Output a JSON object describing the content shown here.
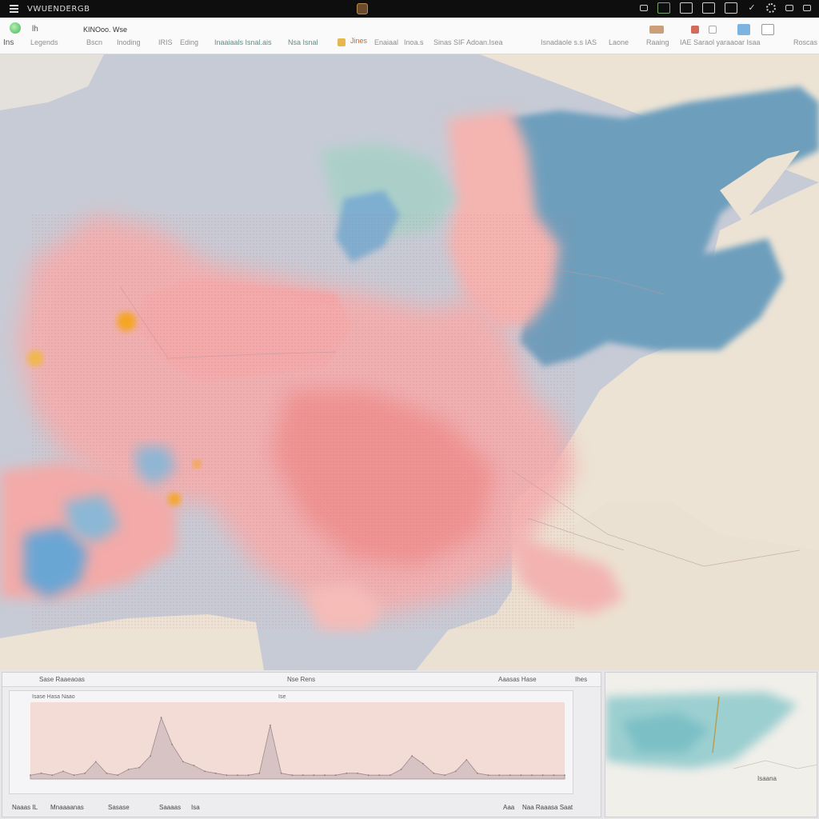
{
  "app": {
    "title": "VWUENDERGB"
  },
  "toolbar": {
    "left_label": "lh",
    "left_sub": "Ins",
    "section_a": "KINOoo. Wse",
    "items": [
      "Legends",
      "Bscn",
      "Inoding",
      "IRIS",
      "Eding",
      "Inaaiaals Isnal.ais",
      "Nsa Isnal",
      "Jines",
      "Enaiaal",
      "Inoa.s",
      "Sinas SIF Adoan.Isea",
      "Isnadaole s.s IAS",
      "Laone",
      "Raaing",
      "IAE Saraol yaraaoar Isaa",
      "Roscas"
    ]
  },
  "chart_panel": {
    "header_left": "Sase Raaeaoas",
    "header_mid": "Nse Rens",
    "header_right": "Aaasas Hase",
    "header_far": "Ihes",
    "plot_title": "Isase Hasa Naao",
    "plot_mid": "Ise",
    "footer": [
      "Naaas IL",
      "Mnaaaanas",
      "Sasase",
      "Saaaas",
      "Isa",
      "Aaa",
      "Naa Raaasa Saat"
    ]
  },
  "chart_data": {
    "type": "area",
    "series": [
      {
        "values": [
          2,
          3,
          2,
          4,
          2,
          3,
          9,
          3,
          2,
          5,
          6,
          12,
          32,
          18,
          9,
          7,
          4,
          3,
          2,
          2,
          2,
          3,
          28,
          3,
          2,
          2,
          2,
          2,
          2,
          3,
          3,
          2,
          2,
          2,
          5,
          12,
          8,
          3,
          2,
          4,
          10,
          3,
          2,
          2,
          2,
          2,
          2,
          2,
          2,
          2
        ]
      }
    ],
    "grid": false
  },
  "side_panel": {
    "title": "Ihes",
    "label": "Isaana"
  },
  "colors": {
    "map_background": "#c8ccd6",
    "land": "#ece1d3",
    "hot": "#f08e8f",
    "warm": "#f4b4b0",
    "cool": "#6d9fbd",
    "lake": "#7faac7",
    "highlight": "#f5a623"
  }
}
